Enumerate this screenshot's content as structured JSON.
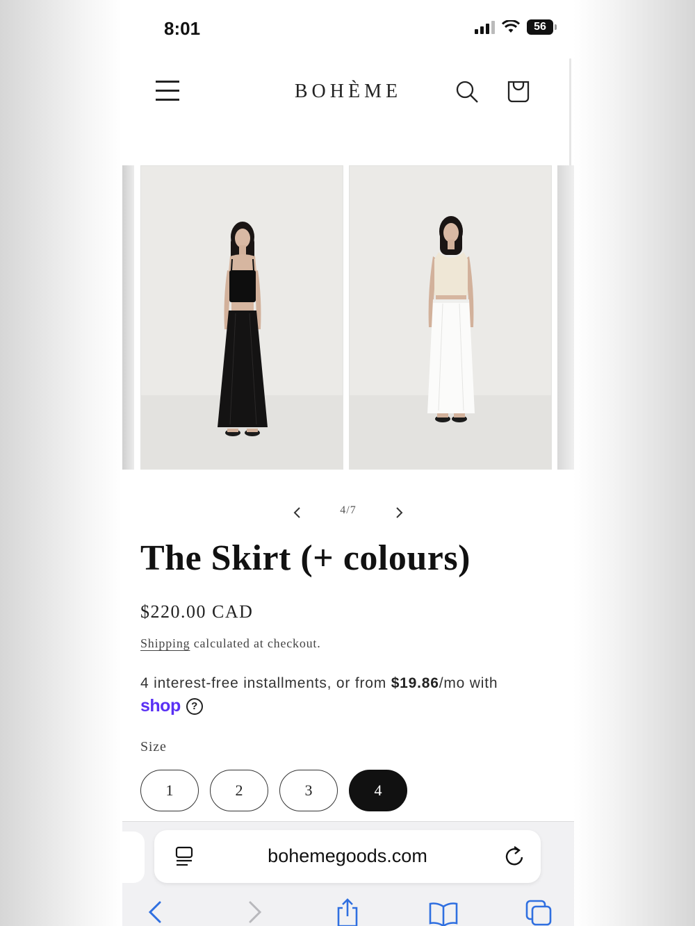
{
  "status_bar": {
    "time": "8:01",
    "battery": "56"
  },
  "header": {
    "logo": "BOHÈME"
  },
  "gallery": {
    "counter": "4/7"
  },
  "product": {
    "title": "The Skirt (+ colours)",
    "price": "$220.00 CAD",
    "shipping_link": "Shipping",
    "shipping_rest": " calculated at checkout.",
    "installments_prefix": "4 interest-free installments, or from ",
    "installments_amount": "$19.86",
    "installments_suffix": "/mo with",
    "shop_logo": "shop",
    "help": "?",
    "size_label": "Size",
    "sizes": [
      "1",
      "2",
      "3",
      "4"
    ],
    "selected_size": "4"
  },
  "browser": {
    "url": "bohemegoods.com"
  },
  "icons": [
    "menu-icon",
    "search-icon",
    "shopping-bag-icon",
    "chevron-left-icon",
    "chevron-right-icon",
    "tab-overview-icon",
    "reload-icon",
    "back-icon",
    "forward-icon",
    "share-icon",
    "bookmarks-icon",
    "tabs-icon"
  ],
  "colors": {
    "shop_pay": "#5a31f4",
    "selected_size_bg": "#111111"
  }
}
